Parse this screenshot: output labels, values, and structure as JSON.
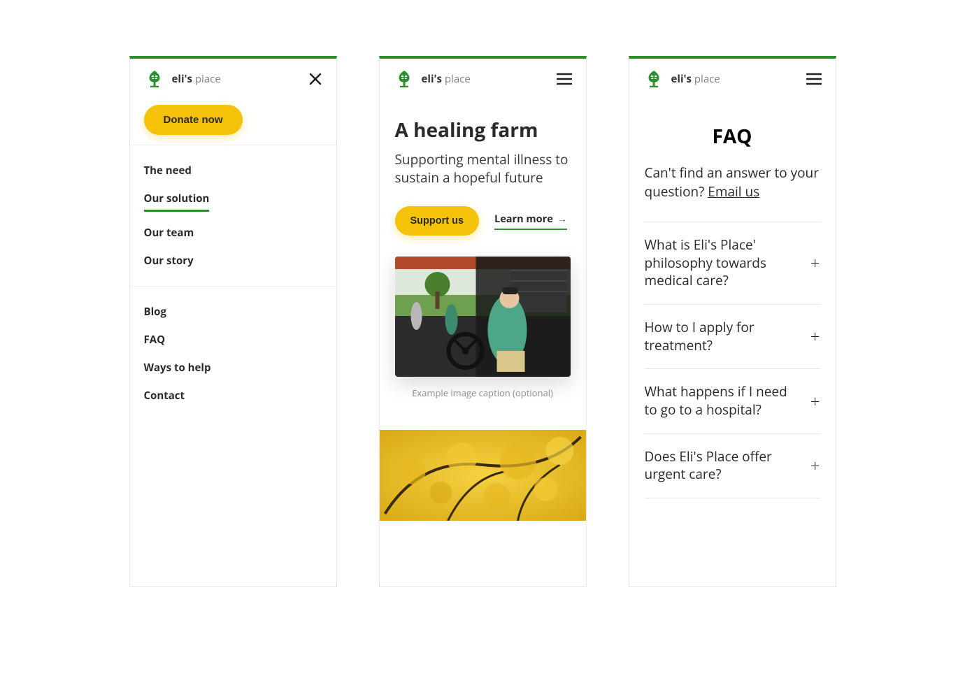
{
  "brand": {
    "bold": "eli's",
    "light": " place"
  },
  "screen1": {
    "donate": "Donate now",
    "nav1": [
      "The need",
      "Our solution",
      "Our team",
      "Our story"
    ],
    "active_index": 1,
    "nav2": [
      "Blog",
      "FAQ",
      "Ways to help",
      "Contact"
    ]
  },
  "screen2": {
    "title": "A healing farm",
    "subtitle": "Supporting mental illness to sustain a hopeful future",
    "support": "Support us",
    "learn_more": "Learn more",
    "arrow": "→",
    "caption": "Example image caption (optional)"
  },
  "screen3": {
    "title": "FAQ",
    "intro_prefix": "Can't find an answer to your question? ",
    "email": "Email us",
    "items": [
      "What is Eli's Place' philosophy towards medical care?",
      "How to I apply for treatment?",
      "What happens if I need to go to a hospital?",
      "Does Eli's Place offer urgent care?"
    ]
  }
}
